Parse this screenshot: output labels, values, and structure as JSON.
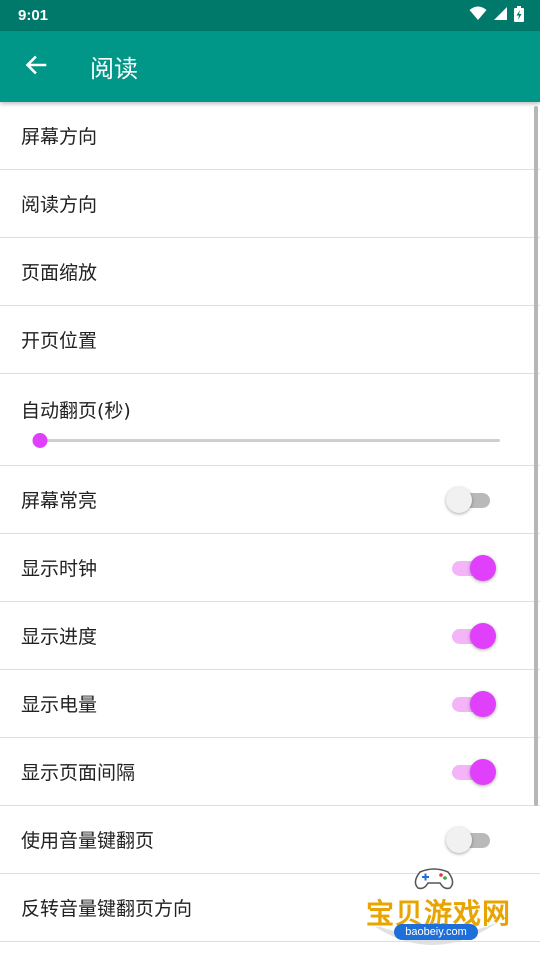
{
  "status_bar": {
    "time": "9:01"
  },
  "app_bar": {
    "title": "阅读"
  },
  "settings": [
    {
      "label": "屏幕方向",
      "type": "nav"
    },
    {
      "label": "阅读方向",
      "type": "nav"
    },
    {
      "label": "页面缩放",
      "type": "nav"
    },
    {
      "label": "开页位置",
      "type": "nav"
    },
    {
      "label": "自动翻页(秒)",
      "type": "slider",
      "value": 0
    },
    {
      "label": "屏幕常亮",
      "type": "switch",
      "on": false
    },
    {
      "label": "显示时钟",
      "type": "switch",
      "on": true
    },
    {
      "label": "显示进度",
      "type": "switch",
      "on": true
    },
    {
      "label": "显示电量",
      "type": "switch",
      "on": true
    },
    {
      "label": "显示页面间隔",
      "type": "switch",
      "on": true
    },
    {
      "label": "使用音量键翻页",
      "type": "switch",
      "on": false
    },
    {
      "label": "反转音量键翻页方向",
      "type": "nav"
    }
  ],
  "watermark": {
    "title": "宝贝游戏网",
    "domain": "baobeiy.com"
  },
  "colors": {
    "status_bar": "#00796b",
    "app_bar": "#009688",
    "accent": "#e040fb",
    "switch_track_on": "#f3b4f8",
    "switch_track_off": "#b9b9b9"
  },
  "icons": [
    "wifi-icon",
    "cell-signal-icon",
    "battery-icon",
    "back-arrow-icon"
  ]
}
